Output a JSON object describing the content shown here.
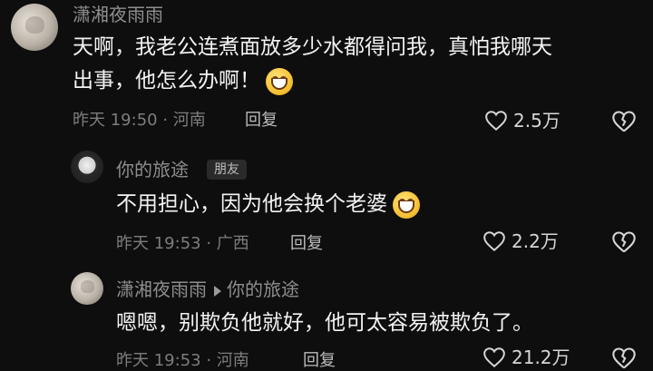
{
  "comments": [
    {
      "author": "潇湘夜雨雨",
      "text_line1": "天啊，我老公连煮面放多少水都得问我，真怕我哪天",
      "text_line2": "出事，他怎么办啊！",
      "emoji_icon": "grin-sweat-emoji",
      "time_location": "昨天 19:50 · 河南",
      "reply_label": "回复",
      "likes": "2.5万"
    },
    {
      "author": "你的旅途",
      "badge": "朋友",
      "text": "不用担心，因为他会换个老婆",
      "emoji_icon": "big-grin-emoji",
      "time_location": "昨天 19:53 · 广西",
      "reply_label": "回复",
      "likes": "2.2万"
    },
    {
      "author": "潇湘夜雨雨",
      "reply_to": "你的旅途",
      "text": "嗯嗯，别欺负他就好，他可太容易被欺负了。",
      "time_location": "昨天 19:53 · 河南",
      "reply_label": "回复",
      "likes": "21.2万"
    }
  ]
}
